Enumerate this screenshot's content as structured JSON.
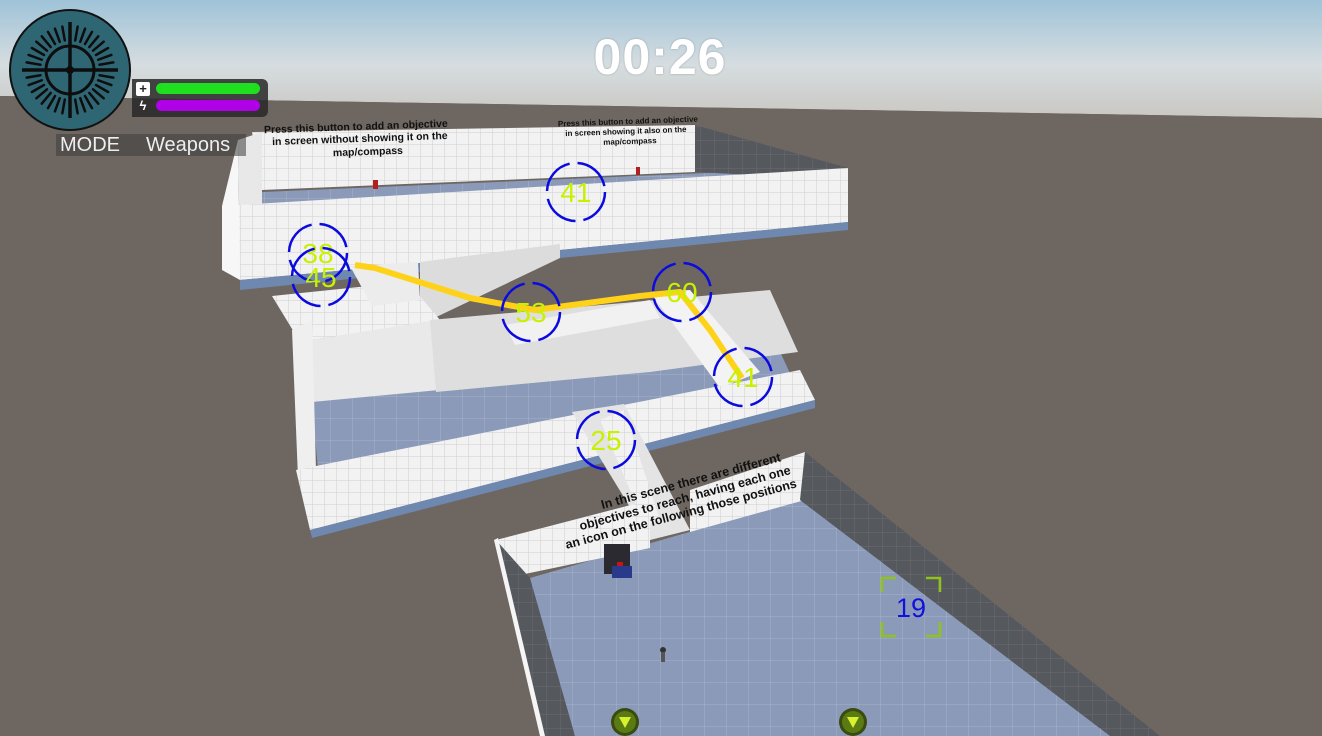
{
  "hud": {
    "timer": "00:26",
    "mode_label": "MODE",
    "weapons_label": "Weapons",
    "health_icon": "plus-icon",
    "energy_icon": "lightning-icon",
    "health_level": 1.0,
    "energy_level": 1.0,
    "health_color": "#1fe01f",
    "energy_color": "#b000e8"
  },
  "scene": {
    "sign_top_left": [
      "Press this button to add an objective",
      "in screen without showing it on the",
      "map/compass"
    ],
    "sign_top_right": [
      "Press this button to add an objective",
      "in screen showing it also on the",
      "map/compass"
    ],
    "sign_middle": [
      "In this scene there are different",
      "objectives to reach, having each one",
      "an icon on the following those positions"
    ]
  },
  "objectives": {
    "markers": [
      "41",
      "38",
      "45",
      "53",
      "60",
      "41",
      "25"
    ],
    "target_distance": "19",
    "marker_color": "#c8f000",
    "ring_color": "#0000ee"
  }
}
